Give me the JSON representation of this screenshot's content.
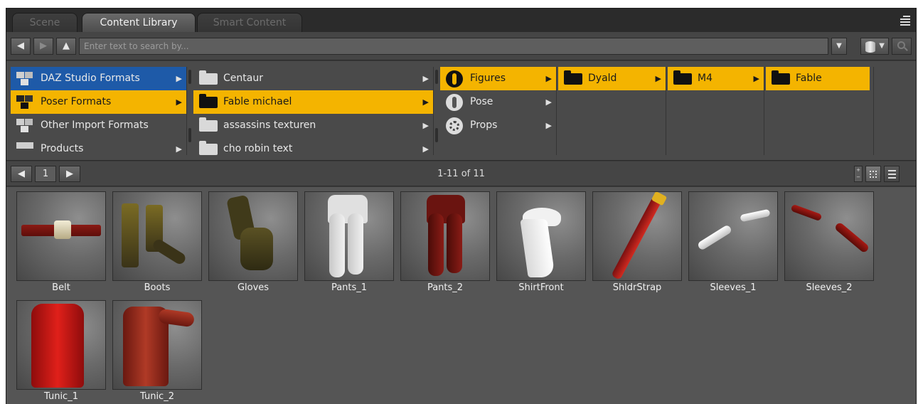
{
  "tabs": [
    {
      "label": "Scene",
      "active": false
    },
    {
      "label": "Content Library",
      "active": true
    },
    {
      "label": "Smart Content",
      "active": false
    }
  ],
  "toolbar": {
    "back": "◀",
    "forward": "▶",
    "up": "▲",
    "search_placeholder": "Enter text to search by...",
    "dropdown": "▼"
  },
  "columns": {
    "col1": [
      {
        "label": "DAZ Studio Formats",
        "state": "blue",
        "arrow": "▶"
      },
      {
        "label": "Poser Formats",
        "state": "yellow",
        "arrow": "▶"
      },
      {
        "label": "Other Import Formats",
        "state": "none",
        "arrow": ""
      },
      {
        "label": "Products",
        "state": "none",
        "arrow": "▶"
      }
    ],
    "col2": [
      {
        "label": "Centaur",
        "state": "none",
        "arrow": "▶"
      },
      {
        "label": "Fable michael",
        "state": "yellow",
        "arrow": "▶"
      },
      {
        "label": "assassins texturen",
        "state": "none",
        "arrow": "▶"
      },
      {
        "label": "cho robin text",
        "state": "none",
        "arrow": "▶"
      }
    ],
    "col3": [
      {
        "label": "Figures",
        "state": "yellow",
        "arrow": "▶"
      },
      {
        "label": "Pose",
        "state": "none",
        "arrow": "▶"
      },
      {
        "label": "Props",
        "state": "none",
        "arrow": "▶"
      }
    ],
    "col4": [
      {
        "label": "Dyald",
        "state": "yellow",
        "arrow": "▶"
      }
    ],
    "col5": [
      {
        "label": "M4",
        "state": "yellow",
        "arrow": "▶"
      }
    ],
    "col6": [
      {
        "label": "Fable",
        "state": "yellow",
        "arrow": ""
      }
    ]
  },
  "pager": {
    "prev": "◀",
    "page": "1",
    "next": "▶",
    "count": "1-11 of 11"
  },
  "items": [
    {
      "label": "Belt",
      "icon": "belt"
    },
    {
      "label": "Boots",
      "icon": "boots"
    },
    {
      "label": "Gloves",
      "icon": "glove"
    },
    {
      "label": "Pants_1",
      "icon": "pants-white"
    },
    {
      "label": "Pants_2",
      "icon": "pants-red"
    },
    {
      "label": "ShirtFront",
      "icon": "shirtfront"
    },
    {
      "label": "ShldrStrap",
      "icon": "strap"
    },
    {
      "label": "Sleeves_1",
      "icon": "sleeves-white"
    },
    {
      "label": "Sleeves_2",
      "icon": "sleeves-red"
    },
    {
      "label": "Tunic_1",
      "icon": "tunic-red"
    },
    {
      "label": "Tunic_2",
      "icon": "tunic-brown"
    }
  ],
  "colors": {
    "selected_yellow": "#f4b400",
    "selected_blue": "#1e5aa8",
    "panel": "#3a3a3a",
    "grid_bg": "#555555"
  }
}
